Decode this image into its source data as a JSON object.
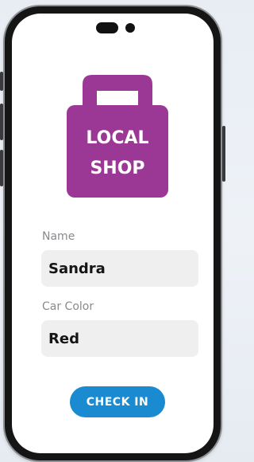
{
  "logo": {
    "line1": "LOCAL",
    "line2": "SHOP",
    "color": "#9b3794"
  },
  "form": {
    "name_label": "Name",
    "name_value": "Sandra",
    "car_color_label": "Car Color",
    "car_color_value": "Red"
  },
  "actions": {
    "check_in_label": "CHECK IN",
    "accent": "#1a8bd0"
  }
}
